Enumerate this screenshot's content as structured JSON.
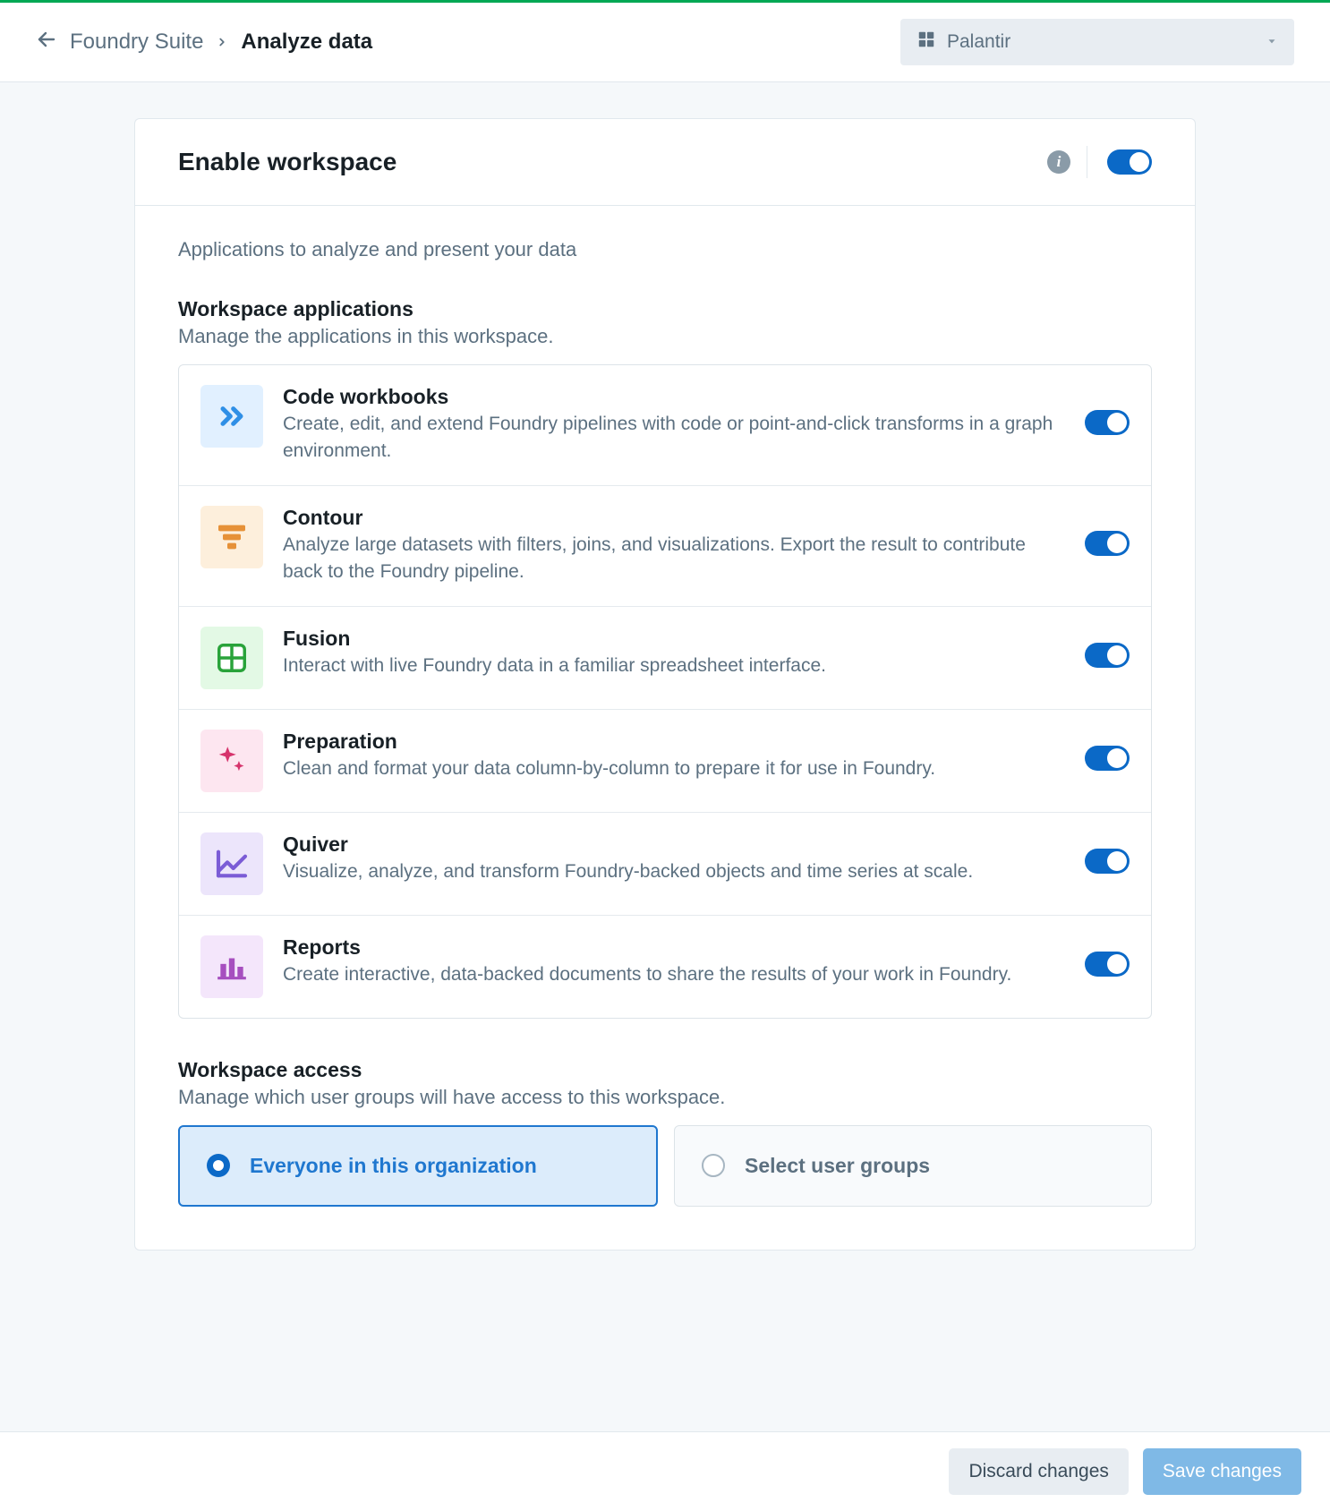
{
  "breadcrumbs": {
    "parent": "Foundry Suite",
    "current": "Analyze data"
  },
  "org_selector": {
    "value": "Palantir"
  },
  "panel": {
    "title": "Enable workspace",
    "enabled": true,
    "description": "Applications to analyze and present your data"
  },
  "apps_section": {
    "title": "Workspace applications",
    "subtitle": "Manage the applications in this workspace."
  },
  "apps": [
    {
      "icon": "double-chevron-icon",
      "icon_class": "icon-code",
      "name": "Code workbooks",
      "desc": "Create, edit, and extend Foundry pipelines with code or point-and-click transforms in a graph environment.",
      "enabled": true
    },
    {
      "icon": "funnel-icon",
      "icon_class": "icon-contour",
      "name": "Contour",
      "desc": "Analyze large datasets with filters, joins, and visualizations. Export the result to contribute back to the Foundry pipeline.",
      "enabled": true
    },
    {
      "icon": "grid-icon",
      "icon_class": "icon-fusion",
      "name": "Fusion",
      "desc": "Interact with live Foundry data in a familiar spreadsheet interface.",
      "enabled": true
    },
    {
      "icon": "sparkle-icon",
      "icon_class": "icon-prep",
      "name": "Preparation",
      "desc": "Clean and format your data column-by-column to prepare it for use in Foundry.",
      "enabled": true
    },
    {
      "icon": "line-chart-icon",
      "icon_class": "icon-quiver",
      "name": "Quiver",
      "desc": "Visualize, analyze, and transform Foundry-backed objects and time series at scale.",
      "enabled": true
    },
    {
      "icon": "bar-chart-icon",
      "icon_class": "icon-reports",
      "name": "Reports",
      "desc": "Create interactive, data-backed documents to share the results of your work in Foundry.",
      "enabled": true
    }
  ],
  "access_section": {
    "title": "Workspace access",
    "subtitle": "Manage which user groups will have access to this workspace."
  },
  "access_options": {
    "everyone": "Everyone in this organization",
    "select_groups": "Select user groups",
    "selected": "everyone"
  },
  "footer": {
    "discard": "Discard changes",
    "save": "Save changes"
  }
}
